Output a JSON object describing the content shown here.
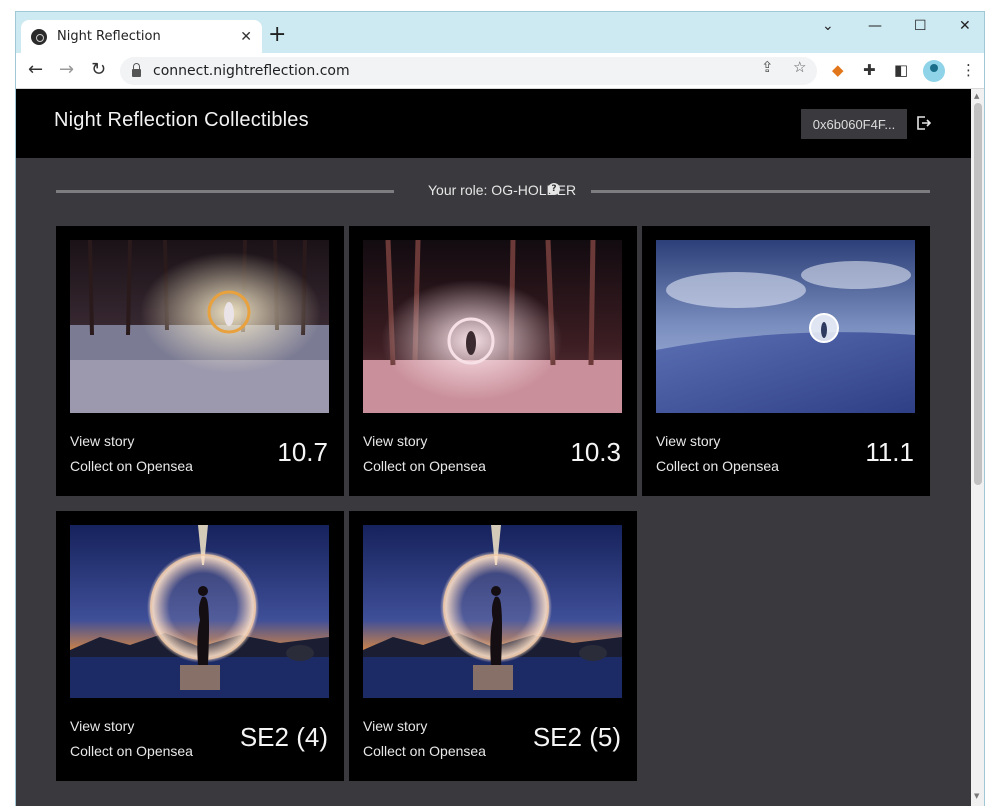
{
  "browser": {
    "tab_title": "Night Reflection",
    "url": "connect.nightreflection.com"
  },
  "site": {
    "title": "Night Reflection Collectibles",
    "wallet": "0x6b060F4F..."
  },
  "role": {
    "text": "Your role: OG-HOLDER",
    "help": "?"
  },
  "cards": [
    {
      "story": "View story",
      "collect": "Collect on Opensea",
      "number": "10.7"
    },
    {
      "story": "View story",
      "collect": "Collect on Opensea",
      "number": "10.3"
    },
    {
      "story": "View story",
      "collect": "Collect on Opensea",
      "number": "11.1"
    },
    {
      "story": "View story",
      "collect": "Collect on Opensea",
      "number": "SE2 (4)"
    },
    {
      "story": "View story",
      "collect": "Collect on Opensea",
      "number": "SE2 (5)"
    }
  ],
  "colors": {
    "header_bg": "#000000",
    "page_bg": "#3a3a3e",
    "card_bg": "#000000",
    "chrome_bg": "#cde9f2"
  },
  "icons": {
    "back": "arrow-left-icon",
    "forward": "arrow-right-icon",
    "reload": "reload-icon",
    "share": "share-icon",
    "bookmark": "star-icon",
    "metamask": "fox-icon",
    "extensions": "puzzle-icon",
    "sidepanel": "side-panel-icon",
    "menu": "kebab-menu-icon",
    "logout": "logout-icon"
  }
}
